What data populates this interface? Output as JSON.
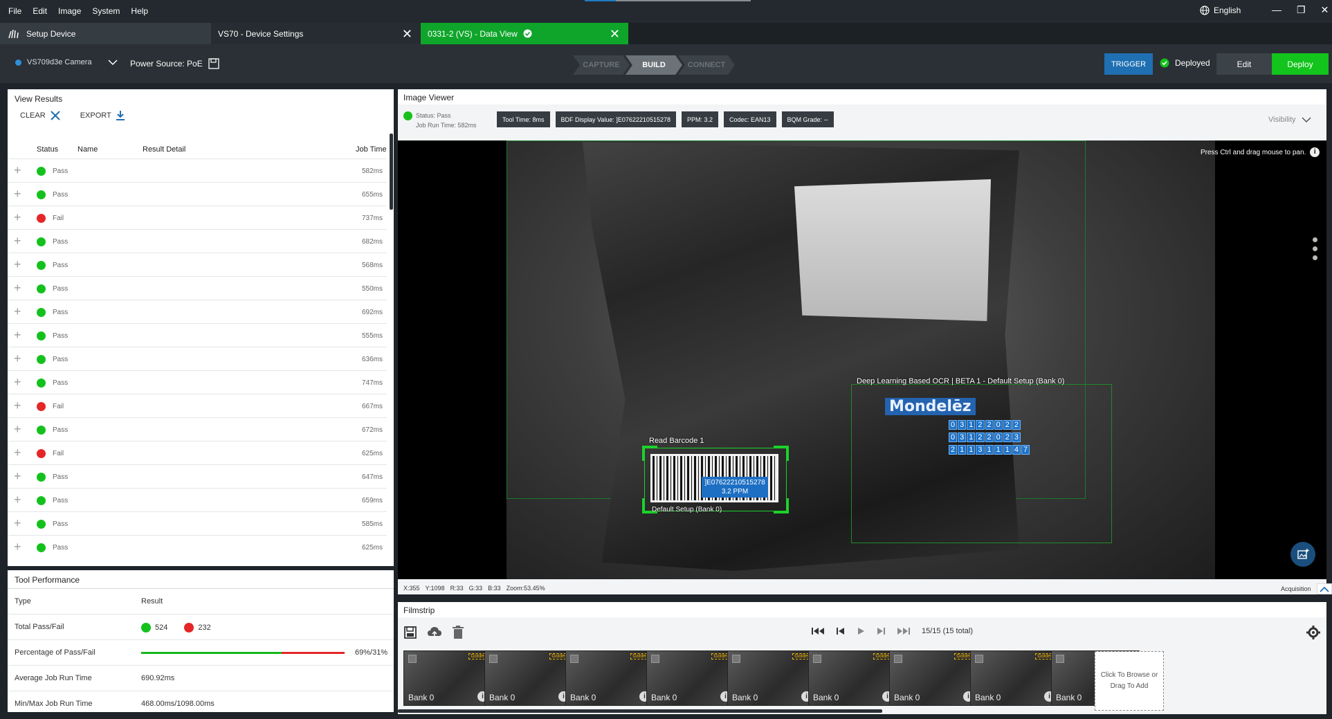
{
  "menu": {
    "items": [
      "File",
      "Edit",
      "Image",
      "System",
      "Help"
    ],
    "language": "English"
  },
  "tabs": [
    {
      "label": "Setup Device"
    },
    {
      "label": "VS70 - Device Settings"
    },
    {
      "label": "0331-2  (VS) - Data View"
    }
  ],
  "toolbar": {
    "camera": "VS709d3e Camera",
    "power_source": "Power Source: PoE",
    "steps": [
      "CAPTURE",
      "BUILD",
      "CONNECT"
    ],
    "trigger": "TRIGGER",
    "deployed": "Deployed",
    "edit": "Edit",
    "deploy": "Deploy"
  },
  "view_results": {
    "title": "View Results",
    "clear": "CLEAR",
    "export": "EXPORT",
    "columns": {
      "status": "Status",
      "name": "Name",
      "detail": "Result Detail",
      "job_time": "Job Time"
    },
    "rows": [
      {
        "status": "Pass",
        "time": "582ms"
      },
      {
        "status": "Pass",
        "time": "655ms"
      },
      {
        "status": "Fail",
        "time": "737ms"
      },
      {
        "status": "Pass",
        "time": "682ms"
      },
      {
        "status": "Pass",
        "time": "568ms"
      },
      {
        "status": "Pass",
        "time": "550ms"
      },
      {
        "status": "Pass",
        "time": "692ms"
      },
      {
        "status": "Pass",
        "time": "555ms"
      },
      {
        "status": "Pass",
        "time": "636ms"
      },
      {
        "status": "Pass",
        "time": "747ms"
      },
      {
        "status": "Fail",
        "time": "667ms"
      },
      {
        "status": "Pass",
        "time": "672ms"
      },
      {
        "status": "Fail",
        "time": "625ms"
      },
      {
        "status": "Pass",
        "time": "647ms"
      },
      {
        "status": "Pass",
        "time": "659ms"
      },
      {
        "status": "Pass",
        "time": "585ms"
      },
      {
        "status": "Pass",
        "time": "625ms"
      }
    ]
  },
  "tool_performance": {
    "title": "Tool Performance",
    "type_header": "Type",
    "result_header": "Result",
    "total_label": "Total Pass/Fail",
    "pass_count": "524",
    "fail_count": "232",
    "pct_label": "Percentage of Pass/Fail",
    "pct_value": "69%/31%",
    "pass_fraction": 0.69,
    "avg_label": "Average Job Run Time",
    "avg_value": "690.92ms",
    "minmax_label": "Min/Max Job Run Time",
    "minmax_value": "468.00ms/1098.00ms"
  },
  "image_viewer": {
    "title": "Image Viewer",
    "status": "Status:  Pass",
    "job_run_time": "Job Run Time:  582ms",
    "chips": [
      "Tool Time:  8ms",
      "BDF Display Value:  ]E07622210515278",
      "PPM:  3.2",
      "Codec:  EAN13",
      "BQM Grade:  --"
    ],
    "visibility": "Visibility",
    "pan_hint": "Press Ctrl and drag mouse to pan.",
    "read_barcode": "Read Barcode 1",
    "barcode_value": "]E07622210515278",
    "barcode_ppm": "3.2 PPM",
    "default_setup": "Default Setup (Bank 0)",
    "ocr_title": "Deep Learning Based OCR | BETA 1 - Default Setup (Bank 0)",
    "ocr_line1": [
      "0",
      "3",
      "1",
      "2",
      "2",
      "0",
      "2",
      "2"
    ],
    "ocr_line2": [
      "0",
      "3",
      "1",
      "2",
      "2",
      "0",
      "2",
      "3"
    ],
    "ocr_line3": [
      "2",
      "1",
      "1",
      "3",
      "1",
      "1",
      "1",
      "4",
      "7"
    ],
    "logo": "Mondelēz",
    "coords": [
      "X:355",
      "Y:1098",
      "R:33",
      "G:33",
      "B:33",
      "Zoom:53.45%"
    ],
    "acquisition": "Acquisition"
  },
  "filmstrip": {
    "title": "Filmstrip",
    "counter": "15/15 (15 total)",
    "thumbs": [
      {
        "bank": "Bank 0",
        "golden": "Golden"
      },
      {
        "bank": "Bank 0",
        "golden": "Golden"
      },
      {
        "bank": "Bank 0",
        "golden": "Golden"
      },
      {
        "bank": "Bank 0",
        "golden": "Golden"
      },
      {
        "bank": "Bank 0",
        "golden": "Golden"
      },
      {
        "bank": "Bank 0",
        "golden": "Golden"
      },
      {
        "bank": "Bank 0",
        "golden": "Golden"
      },
      {
        "bank": "Bank 0",
        "golden": "Golden"
      },
      {
        "bank": "Bank 0",
        "golden": "Golden"
      }
    ],
    "add": "Click To Browse or Drag To Add"
  },
  "colors": {
    "pass": "#14c11c",
    "fail": "#e52626",
    "accent": "#1f6fb3",
    "deploy": "#12c41b"
  }
}
